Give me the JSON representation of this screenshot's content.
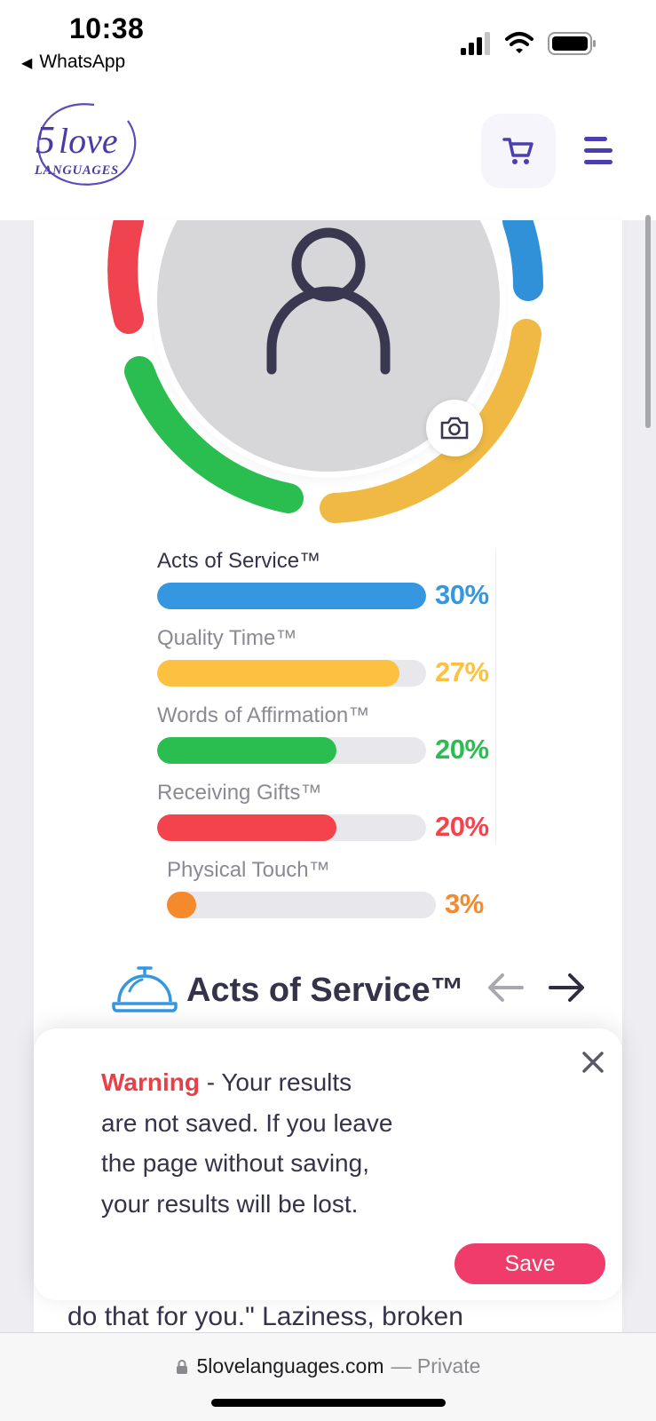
{
  "status_bar": {
    "time": "10:38",
    "back_app": "WhatsApp",
    "icons": [
      "cellular-signal-icon",
      "wifi-icon",
      "battery-icon"
    ]
  },
  "header": {
    "logo_number": "5",
    "logo_word": "love",
    "logo_sub": "LANGUAGES",
    "cart_icon": "shopping-cart-icon",
    "menu_icon": "hamburger-menu-icon"
  },
  "profile": {
    "avatar_icon": "user-silhouette-icon",
    "camera_icon": "camera-icon"
  },
  "results": [
    {
      "name": "Acts of Service™",
      "percent": 30,
      "label": "30%",
      "color": "#3497e0",
      "name_color": "#35334a"
    },
    {
      "name": "Quality Time™",
      "percent": 27,
      "label": "27%",
      "color": "#fcc140",
      "name_color": "#8a8994"
    },
    {
      "name": "Words of Affirmation™",
      "percent": 20,
      "label": "20%",
      "color": "#2abd4f",
      "name_color": "#8a8994"
    },
    {
      "name": "Receiving Gifts™",
      "percent": 20,
      "label": "20%",
      "color": "#f5434d",
      "name_color": "#8a8994"
    },
    {
      "name": "Physical Touch™",
      "percent": 3,
      "label": "3%",
      "color": "#f58a2c",
      "name_color": "#8a8994"
    }
  ],
  "section": {
    "icon": "service-bell-icon",
    "title": "Acts of Service™",
    "prev_icon": "arrow-left-icon",
    "next_icon": "arrow-right-icon"
  },
  "body_text": "do that for you.\" Laziness, broken",
  "warning": {
    "label": "Warning",
    "message": " - Your results are not saved. If you leave the page without saving, your results will be lost.",
    "close_icon": "close-icon",
    "save_label": "Save"
  },
  "browser": {
    "url": "5lovelanguages.com",
    "mode": "— Private",
    "lock_icon": "lock-icon"
  }
}
